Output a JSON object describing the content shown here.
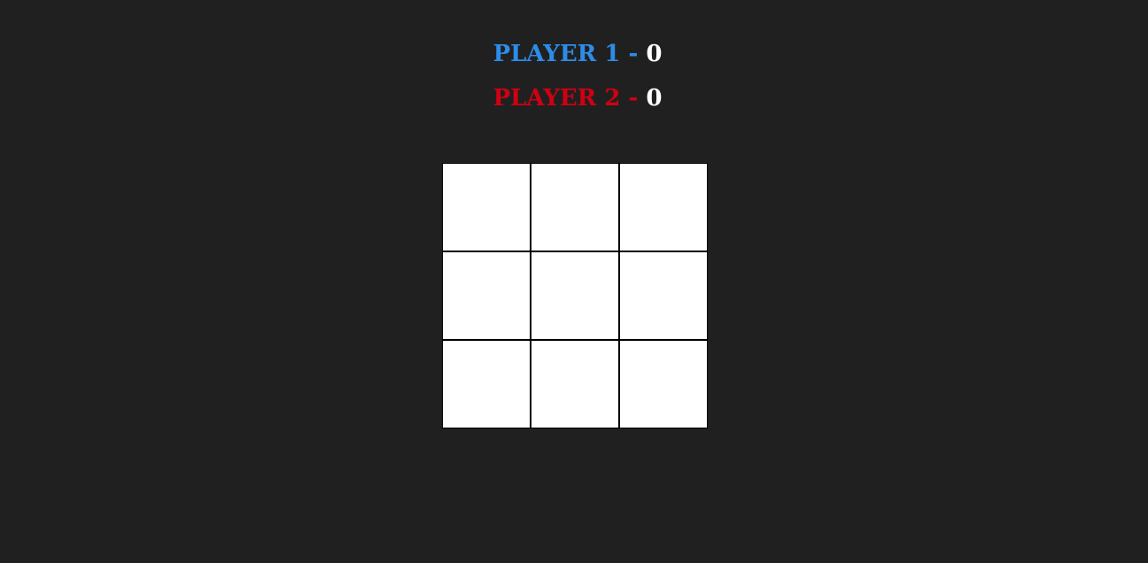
{
  "scoreboard": {
    "player1": {
      "label": "PLAYER 1",
      "separator": "-",
      "score": "0",
      "color": "#2e8ce8"
    },
    "player2": {
      "label": "PLAYER 2",
      "separator": "-",
      "score": "0",
      "color": "#d00012"
    }
  },
  "board": {
    "cells": [
      "",
      "",
      "",
      "",
      "",
      "",
      "",
      "",
      ""
    ]
  }
}
